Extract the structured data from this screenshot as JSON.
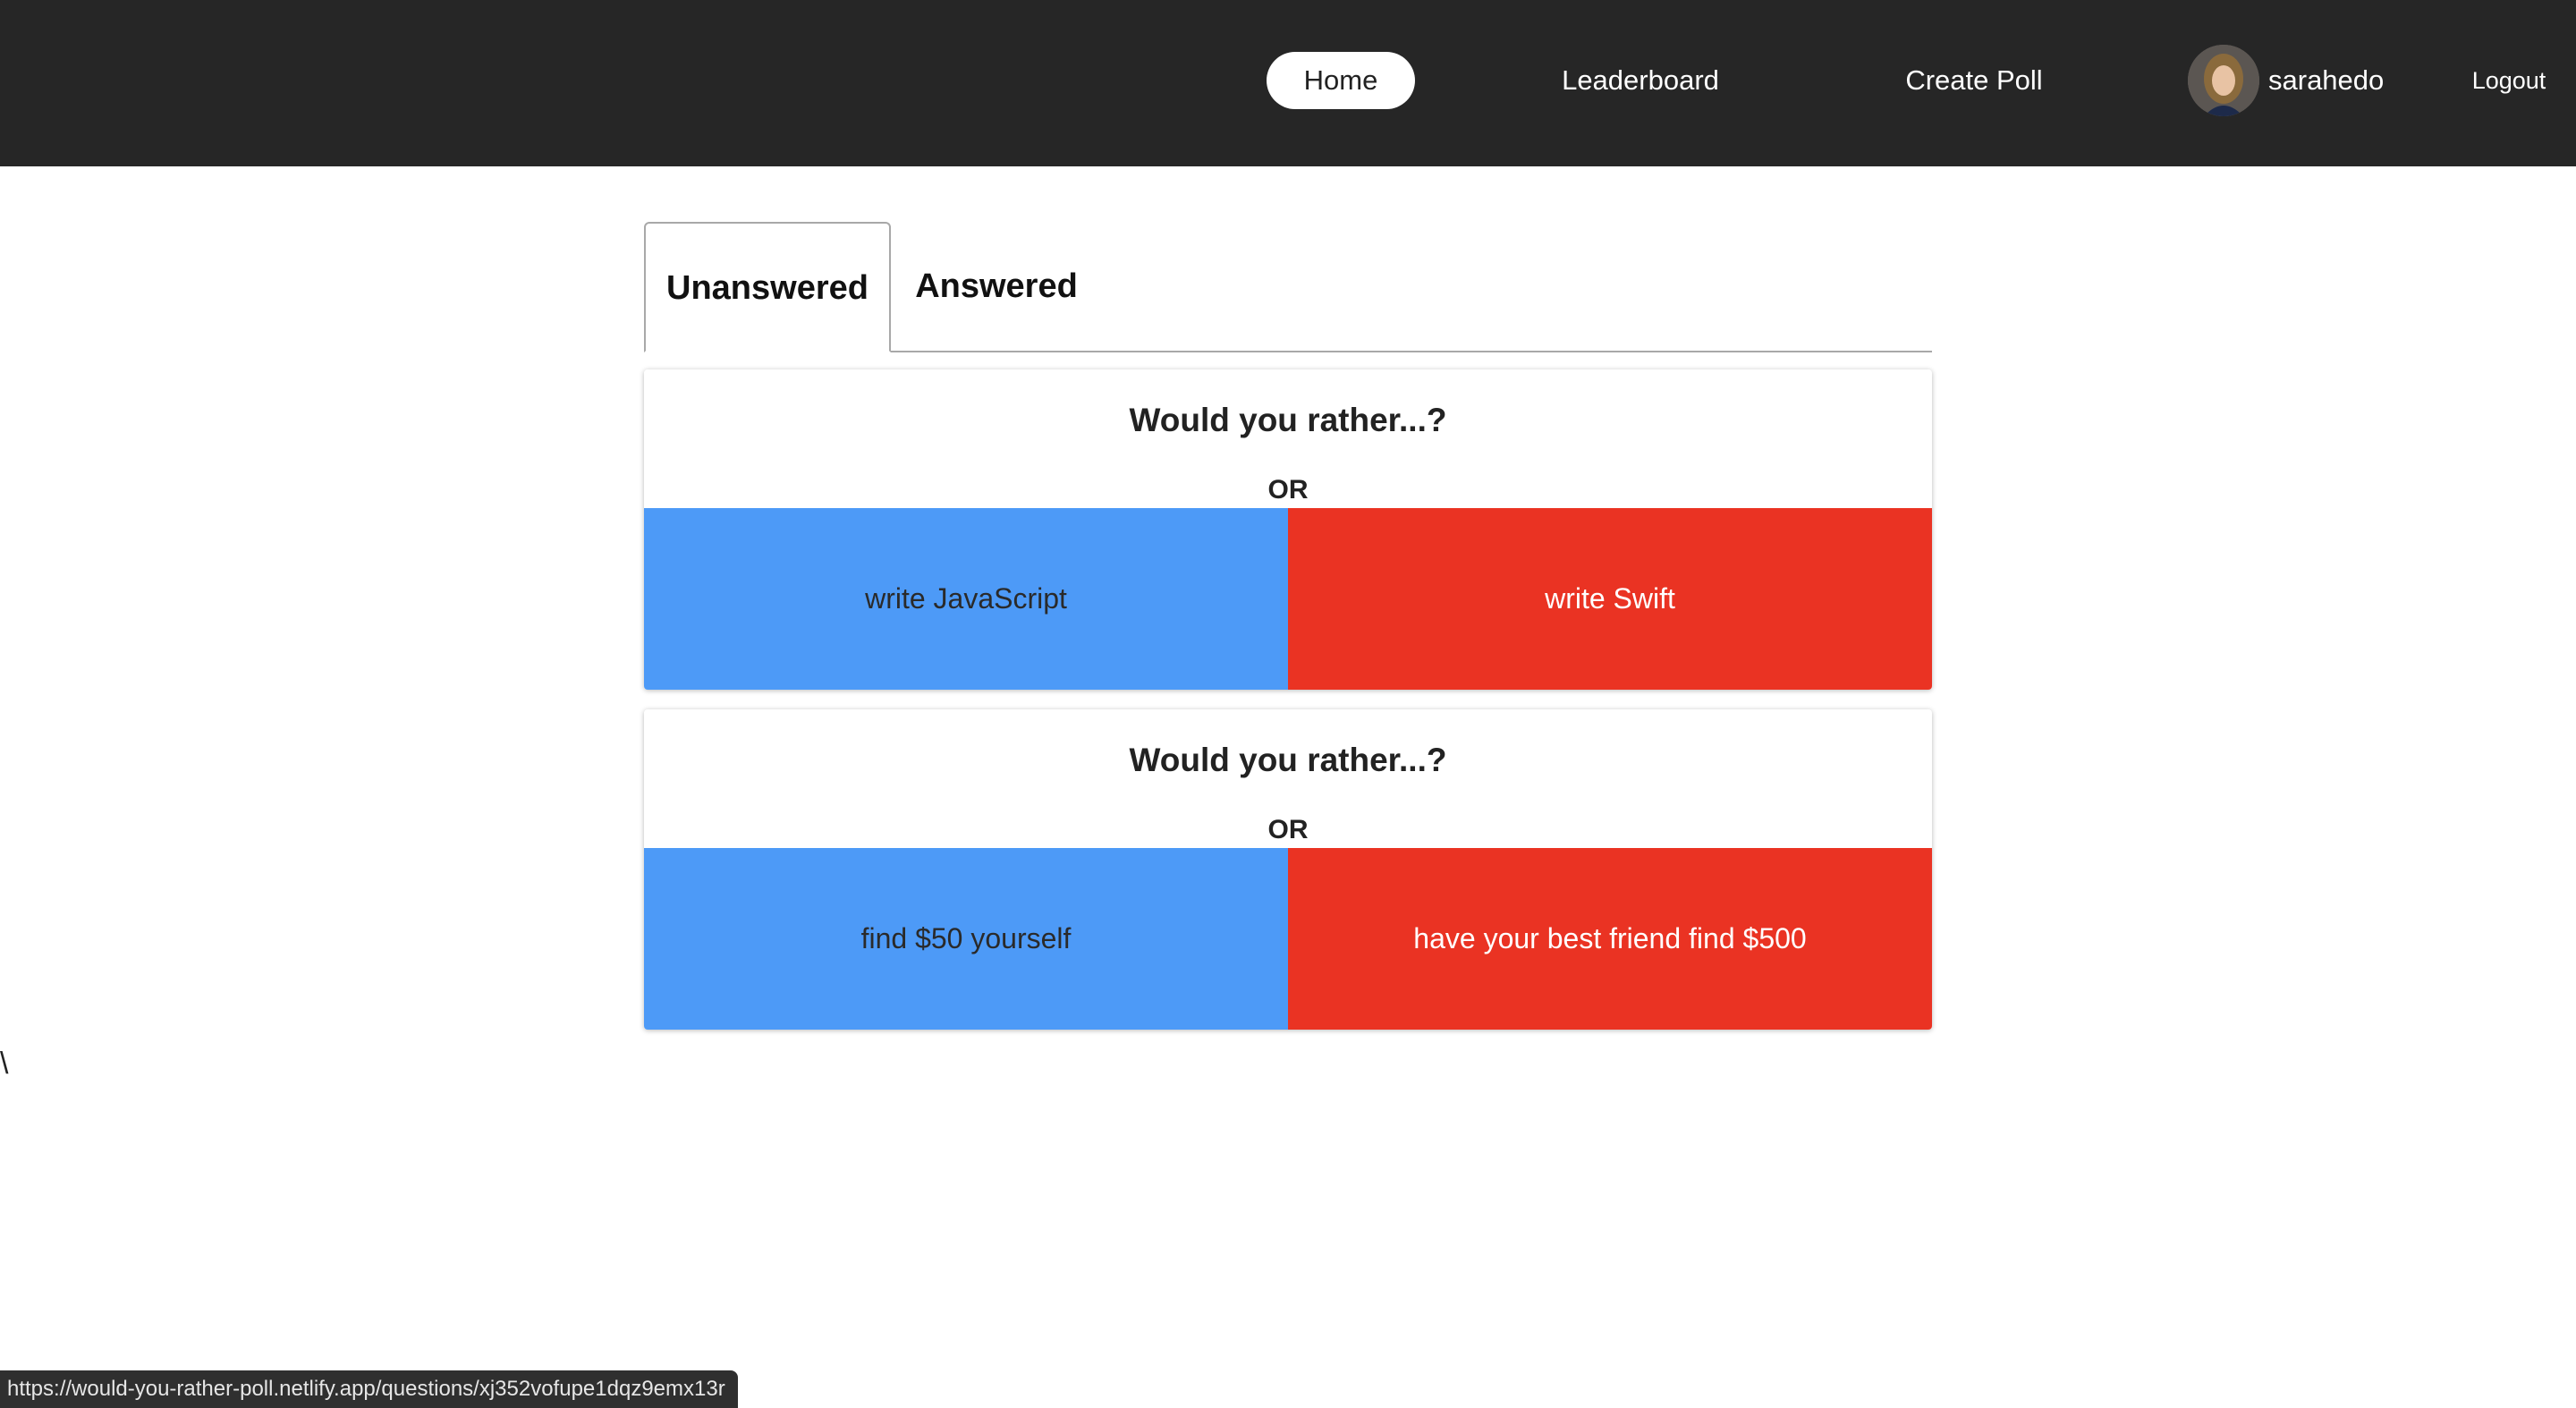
{
  "nav": {
    "home": "Home",
    "leaderboard": "Leaderboard",
    "create_poll": "Create Poll",
    "username": "sarahedo",
    "logout": "Logout"
  },
  "tabs": {
    "unanswered": "Unanswered",
    "answered": "Answered",
    "active": "Unanswered"
  },
  "questions": [
    {
      "title": "Would you rather...?",
      "or": "OR",
      "option_one": "write JavaScript",
      "option_two": "write Swift"
    },
    {
      "title": "Would you rather...?",
      "or": "OR",
      "option_one": "find $50 yourself",
      "option_two": "have your best friend find $500"
    }
  ],
  "stray_text": "\\",
  "status_url": "https://would-you-rather-poll.netlify.app/questions/xj352vofupe1dqz9emx13r",
  "colors": {
    "navbar": "#262626",
    "option_one": "#4d9af7",
    "option_two": "#ea3323"
  }
}
